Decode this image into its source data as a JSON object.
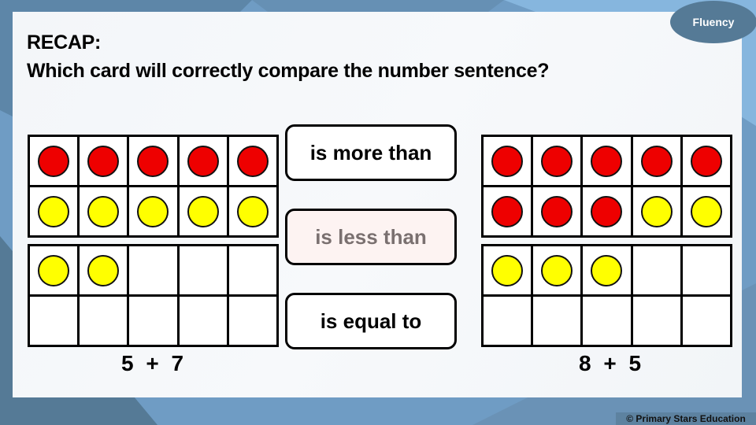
{
  "header": {
    "recap": "RECAP:",
    "question": "Which card will correctly compare the number sentence?",
    "badge": "Fluency"
  },
  "colors": {
    "red": "#ee0000",
    "yellow": "#ffff00",
    "badge": "#557a96",
    "dimmed_card": "#fdf3f2"
  },
  "left": {
    "sentence": "5 + 7",
    "frames": [
      [
        "red",
        "red",
        "red",
        "red",
        "red",
        "yellow",
        "yellow",
        "yellow",
        "yellow",
        "yellow"
      ],
      [
        "yellow",
        "yellow",
        "",
        "",
        "",
        "",
        "",
        "",
        "",
        ""
      ]
    ]
  },
  "right": {
    "sentence": "8 + 5",
    "frames": [
      [
        "red",
        "red",
        "red",
        "red",
        "red",
        "red",
        "red",
        "red",
        "yellow",
        "yellow"
      ],
      [
        "yellow",
        "yellow",
        "yellow",
        "",
        "",
        "",
        "",
        "",
        "",
        ""
      ]
    ]
  },
  "cards": [
    {
      "label": "is more than",
      "dimmed": false
    },
    {
      "label": "is less than",
      "dimmed": true
    },
    {
      "label": "is equal to",
      "dimmed": false
    }
  ],
  "footer": "© Primary Stars Education"
}
